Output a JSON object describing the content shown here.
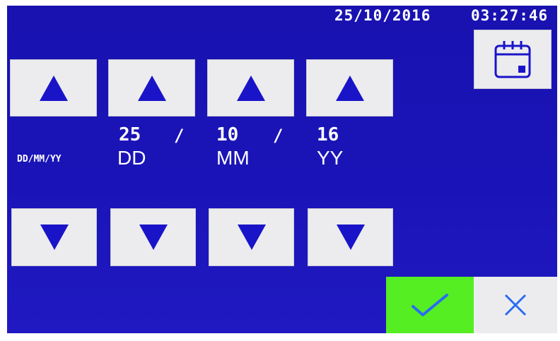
{
  "status_bar": {
    "date": "25/10/2016",
    "time": "03:27:46"
  },
  "icons": {
    "calendar": "calendar-icon",
    "up": "triangle-up-icon",
    "down": "triangle-down-icon",
    "confirm": "checkmark-icon",
    "cancel": "close-icon"
  },
  "format_label": "DD/MM/YY",
  "fields": {
    "day": {
      "value": "25",
      "unit": "DD"
    },
    "month": {
      "value": "10",
      "unit": "MM"
    },
    "year": {
      "value": "16",
      "unit": "YY"
    }
  },
  "separator": "/",
  "colors": {
    "screen_background": "#1a14b8",
    "button_face": "#ececef",
    "arrow": "#1a14c8",
    "confirm_background": "#55ee22",
    "checkmark": "#2a6cf0",
    "cancel_x": "#2a6cf0"
  }
}
